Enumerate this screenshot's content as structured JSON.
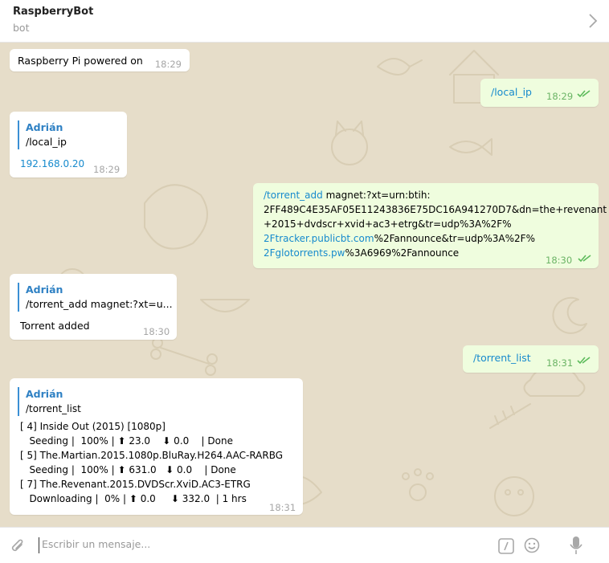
{
  "header": {
    "title": "RaspberryBot",
    "subtitle": "bot",
    "icon": "chevron-right-icon"
  },
  "messages": {
    "m1": {
      "text": "Raspberry Pi powered on",
      "time": "18:29"
    },
    "m2": {
      "command": "/local_ip",
      "time": "18:29"
    },
    "m3": {
      "reply_author": "Adrián",
      "reply_text": "/local_ip",
      "ip": "192.168.0.20",
      "time": "18:29"
    },
    "m4": {
      "command": "/torrent_add",
      "line1_rest": " magnet:?xt=urn:btih:",
      "line2": "2FF489C4E35AF05E11243836E75DC16A941270D7&dn=the+revenant",
      "line3": "+2015+dvdscr+xvid+ac3+etrg&tr=udp%3A%2F%",
      "line4_link": "2Ftracker.publicbt.com",
      "line4_rest": "%2Fannounce&tr=udp%3A%2F%",
      "line5_link": "2Fglotorrents.pw",
      "line5_rest": "%3A6969%2Fannounce",
      "time": "18:30"
    },
    "m5": {
      "reply_author": "Adrián",
      "reply_text": "/torrent_add magnet:?xt=u...",
      "text": "Torrent added",
      "time": "18:30"
    },
    "m6": {
      "command": "/torrent_list",
      "time": "18:31"
    },
    "m7": {
      "reply_author": "Adrián",
      "reply_text": "/torrent_list",
      "lines": [
        "[ 4] Inside Out (2015) [1080p]",
        "   Seeding |  100% | ⬆ 23.0    ⬇ 0.0    | Done",
        "[ 5] The.Martian.2015.1080p.BluRay.H264.AAC-RARBG",
        "   Seeding |  100% | ⬆ 631.0   ⬇ 0.0    | Done",
        "[ 7] The.Revenant.2015.DVDScr.XviD.AC3-ETRG",
        "   Downloading |  0% | ⬆ 0.0     ⬇ 332.0  | 1 hrs"
      ],
      "time": "18:31"
    }
  },
  "composer": {
    "placeholder": "Escribir un mensaje...",
    "icons": [
      "paperclip-icon",
      "slash-command-icon",
      "emoji-icon",
      "microphone-icon"
    ]
  },
  "colors": {
    "chat_background": "#e6ddc9",
    "outgoing_bubble": "#effdde",
    "link": "#168acd",
    "read_checks": "#5dbb5b"
  }
}
